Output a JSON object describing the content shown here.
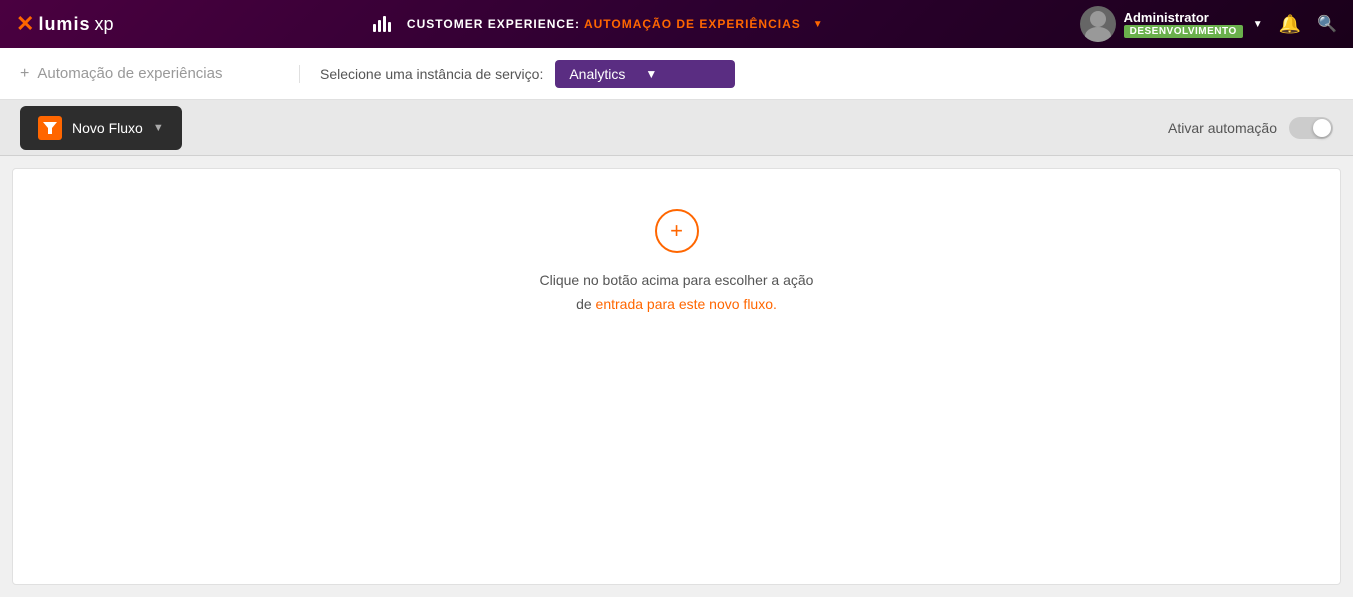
{
  "topNav": {
    "logo": {
      "x": "x",
      "lumis": "lumis",
      "xp": "xp"
    },
    "title": "CUSTOMER EXPERIENCE:",
    "titleHighlight": "AUTOMAÇÃO DE EXPERIÊNCIAS",
    "dropdownIcon": "▼",
    "user": {
      "name": "Administrator",
      "badge": "DESENVOLVIMENTO",
      "dropdownIcon": "▼"
    }
  },
  "subHeader": {
    "breadcrumbPlus": "+",
    "breadcrumbText": "Automação de experiências",
    "serviceLabel": "Selecione uma instância de serviço:",
    "serviceValue": "Analytics",
    "serviceArrow": "▼"
  },
  "toolbar": {
    "newFlowLabel": "Novo Fluxo",
    "dropdownArrow": "▼",
    "activateLabel": "Ativar automação"
  },
  "canvas": {
    "addIcon": "+",
    "hintLine1": "Clique no botão acima para escolher a ação",
    "hintLine2": "de entrada para este novo fluxo."
  }
}
